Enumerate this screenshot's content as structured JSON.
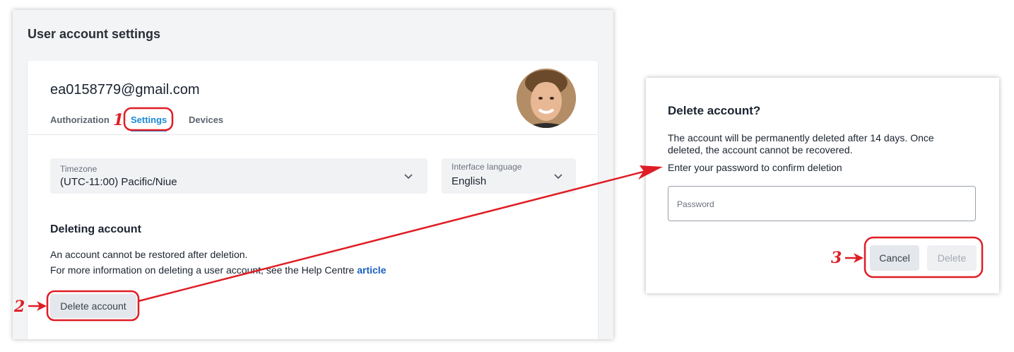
{
  "settings": {
    "title": "User account settings",
    "email": "ea0158779@gmail.com",
    "tabs": [
      "Authorization",
      "Settings",
      "Devices"
    ],
    "active_tab": "Settings",
    "timezone": {
      "label": "Timezone",
      "value": "(UTC-11:00) Pacific/Niue"
    },
    "language": {
      "label": "Interface language",
      "value": "English"
    },
    "deleting": {
      "title": "Deleting account",
      "line1": "An account cannot be restored after deletion.",
      "line2_prefix": "For more information on deleting a user account, see the Help Centre ",
      "link": "article",
      "button": "Delete account"
    }
  },
  "dialog": {
    "title": "Delete account?",
    "text": "The account will be permanently deleted after 14 days. Once deleted, the account cannot be recovered.",
    "prompt": "Enter your password to confirm deletion",
    "password_placeholder": "Password",
    "cancel": "Cancel",
    "delete": "Delete"
  },
  "annotations": {
    "steps": [
      "1",
      "2",
      "3"
    ],
    "color": "#e01d25"
  },
  "colors": {
    "accent": "#1a8ad8",
    "link": "#1b5fc1"
  },
  "icons": [
    "chevron-down-icon",
    "avatar-photo"
  ]
}
